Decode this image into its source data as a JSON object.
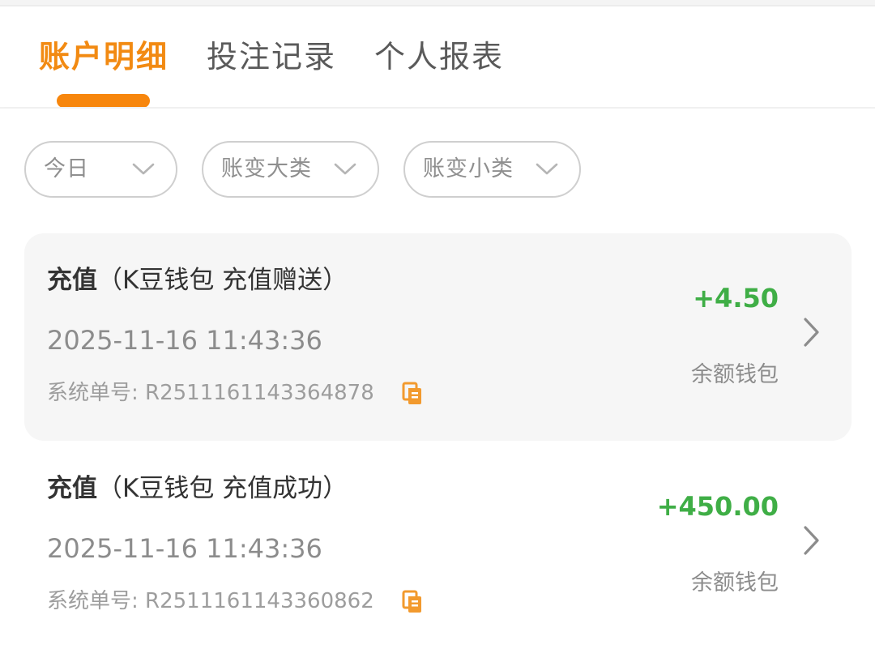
{
  "tabs": [
    {
      "label": "账户明细",
      "active": true
    },
    {
      "label": "投注记录",
      "active": false
    },
    {
      "label": "个人报表",
      "active": false
    }
  ],
  "filters": [
    {
      "label": "今日",
      "icon": "chevron-down-icon"
    },
    {
      "label": "账变大类",
      "icon": "chevron-down-icon"
    },
    {
      "label": "账变小类",
      "icon": "chevron-down-icon"
    }
  ],
  "records": [
    {
      "title_main": "充值",
      "title_detail": "（K豆钱包 充值赠送）",
      "time": "2025-11-16 11:43:36",
      "order_label": "系统单号:",
      "order_no": "R2511161143364878",
      "amount": "+4.50",
      "wallet": "余额钱包"
    },
    {
      "title_main": "充值",
      "title_detail": "（K豆钱包 充值成功）",
      "time": "2025-11-16 11:43:36",
      "order_label": "系统单号:",
      "order_no": "R2511161143360862",
      "amount": "+450.00",
      "wallet": "余额钱包"
    }
  ],
  "colors": {
    "accent": "#f7860d",
    "positive_amount": "#3fae46"
  }
}
